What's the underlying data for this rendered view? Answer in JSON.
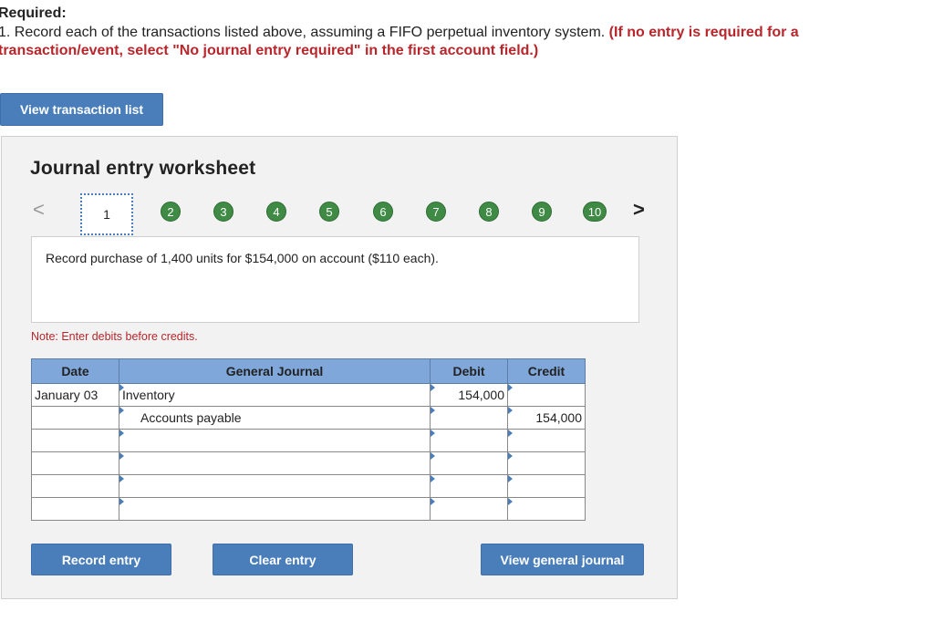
{
  "required": {
    "title": "Required:",
    "line1_prefix": "1. Record each of the transactions listed above, assuming a FIFO perpetual inventory system. ",
    "line1_red": "(If no entry is required for a",
    "line2_red": "transaction/event, select \"No journal entry required\" in the first account field.)"
  },
  "buttons": {
    "view_transaction_list": "View transaction list",
    "record_entry": "Record entry",
    "clear_entry": "Clear entry",
    "view_general_journal": "View general journal"
  },
  "worksheet": {
    "title": "Journal entry worksheet",
    "steps": [
      "1",
      "2",
      "3",
      "4",
      "5",
      "6",
      "7",
      "8",
      "9",
      "10"
    ],
    "current_step": "1",
    "prev_arrow": "<",
    "next_arrow": ">",
    "description": "Record purchase of 1,400 units for $154,000 on account ($110 each).",
    "note": "Note: Enter debits before credits."
  },
  "journal": {
    "headers": {
      "date": "Date",
      "general_journal": "General Journal",
      "debit": "Debit",
      "credit": "Credit"
    },
    "rows": [
      {
        "date": "January 03",
        "account": "Inventory",
        "debit": "154,000",
        "credit": ""
      },
      {
        "date": "",
        "account": "Accounts payable",
        "debit": "",
        "credit": "154,000"
      },
      {
        "date": "",
        "account": "",
        "debit": "",
        "credit": ""
      },
      {
        "date": "",
        "account": "",
        "debit": "",
        "credit": ""
      },
      {
        "date": "",
        "account": "",
        "debit": "",
        "credit": ""
      },
      {
        "date": "",
        "account": "",
        "debit": "",
        "credit": ""
      }
    ]
  },
  "colors": {
    "accent_blue": "#4a7ebb",
    "header_blue": "#7fa7d9",
    "step_green": "#3f8a45",
    "note_red": "#b8262b"
  }
}
